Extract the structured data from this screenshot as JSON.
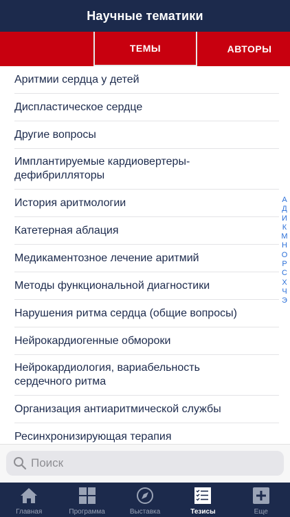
{
  "header": {
    "title": "Научные тематики"
  },
  "tabs": {
    "themes": "ТЕМЫ",
    "authors": "АВТОРЫ"
  },
  "topics": [
    {
      "label": "Аритмии сердца у детей",
      "lines": 1
    },
    {
      "label": "Диспластическое сердце",
      "lines": 1
    },
    {
      "label": "Другие вопросы",
      "lines": 1
    },
    {
      "label": "Имплантируемые кардиовертеры-дефибрилляторы",
      "lines": 2
    },
    {
      "label": "История аритмологии",
      "lines": 1
    },
    {
      "label": "Катетерная аблация",
      "lines": 1
    },
    {
      "label": "Медикаментозное лечение аритмий",
      "lines": 1
    },
    {
      "label": "Методы функциональной диагностики",
      "lines": 1
    },
    {
      "label": "Нарушения ритма сердца (общие вопросы)",
      "lines": 1
    },
    {
      "label": "Нейрокардиогенные обмороки",
      "lines": 1
    },
    {
      "label": "Нейрокардиология, вариабельность сердечного ритма",
      "lines": 2
    },
    {
      "label": "Организация антиаритмической службы",
      "lines": 1
    },
    {
      "label": "Ресинхронизирующая терапия",
      "lines": 1
    }
  ],
  "index_letters": [
    "А",
    "Д",
    "И",
    "К",
    "М",
    "Н",
    "О",
    "Р",
    "С",
    "Х",
    "Ч",
    "Э"
  ],
  "search": {
    "placeholder": "Поиск"
  },
  "bottom_nav": [
    {
      "label": "Главная",
      "icon": "home-icon",
      "active": false
    },
    {
      "label": "Программа",
      "icon": "grid-icon",
      "active": false
    },
    {
      "label": "Выставка",
      "icon": "compass-icon",
      "active": false
    },
    {
      "label": "Тезисы",
      "icon": "checklist-icon",
      "active": true
    },
    {
      "label": "Еще",
      "icon": "plus-icon",
      "active": false
    }
  ],
  "colors": {
    "navy": "#1c2a4c",
    "red": "#c8000f",
    "index_blue": "#2a6fd8"
  }
}
